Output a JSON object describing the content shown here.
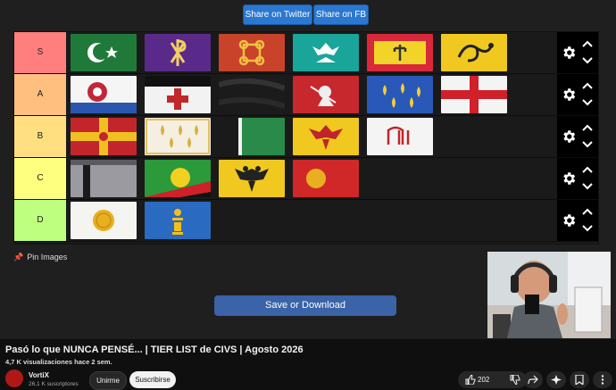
{
  "header": {
    "share_twitter": "Share on Twitter",
    "share_fb": "Share on FB"
  },
  "tiers": [
    {
      "label": "S",
      "color": "#ff7f7f",
      "flags": [
        "green-crescent-flag",
        "purple-chi-rho-flag",
        "red-knot-flag",
        "teal-eagle-flag",
        "yellow-red-symbol-flag",
        "yellow-dragon-flag"
      ]
    },
    {
      "label": "A",
      "color": "#ffbf7f",
      "flags": [
        "tudor-rose-flag",
        "teutonic-cross-flag",
        "black-banner-flag",
        "red-saint-george-flag",
        "blue-fleur-de-lis-flag",
        "white-red-cross-flag"
      ]
    },
    {
      "label": "B",
      "color": "#ffdf7f",
      "flags": [
        "red-yellow-cross-flag",
        "white-fleur-de-lis-flag",
        "green-black-flag",
        "red-eagle-flag",
        "white-red-monogram-flag"
      ]
    },
    {
      "label": "C",
      "color": "#ffff7f",
      "flags": [
        "grey-black-stripe-flag",
        "green-red-disc-flag",
        "yellow-double-eagle-flag",
        "red-gold-disc-flag"
      ]
    },
    {
      "label": "D",
      "color": "#bfff7f",
      "flags": [
        "white-gold-sun-flag",
        "blue-soyombo-flag"
      ]
    }
  ],
  "pin_label": "Pin Images",
  "save_label": "Save or Download",
  "video": {
    "title": "Pasó lo que NUNCA PENSÉ... | TIER LIST de CIVS | Agosto 2026",
    "views": "4,7 K visualizaciones",
    "age": "hace 2 sem.",
    "channel": "VortiX",
    "subscribers": "26,1 K suscriptores",
    "join": "Unirme",
    "subscribe": "Suscribirse",
    "likes": "202"
  }
}
